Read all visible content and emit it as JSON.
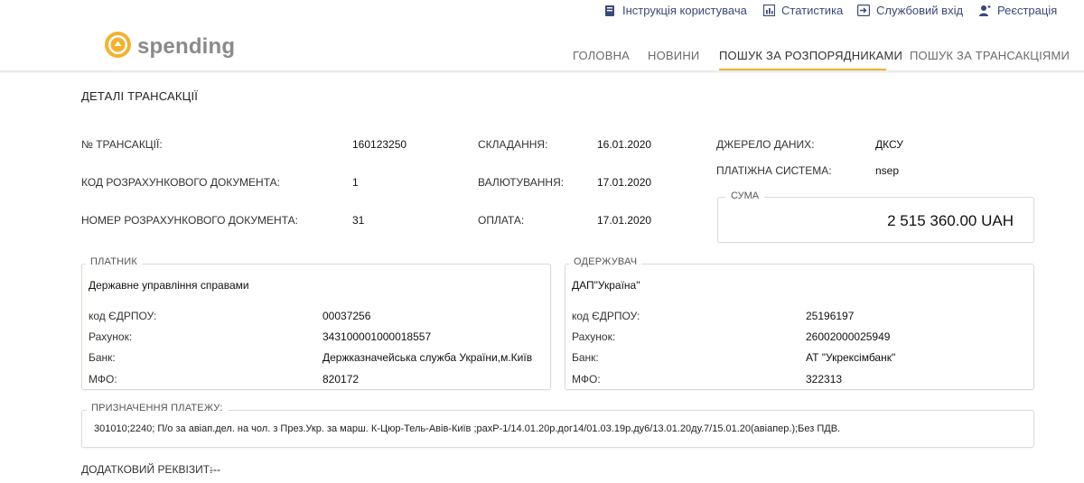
{
  "topbar": {
    "links": [
      {
        "label": "Інструкція користувача",
        "icon": "book-icon"
      },
      {
        "label": "Статистика",
        "icon": "chart-icon"
      },
      {
        "label": "Службовий вхід",
        "icon": "login-icon"
      },
      {
        "label": "Реєстрація",
        "icon": "user-add-icon"
      }
    ]
  },
  "logo": {
    "text": "spending",
    "accent": "#f2b231"
  },
  "nav": {
    "items": [
      "ГОЛОВНА",
      "НОВИНИ",
      "ПОШУК ЗА РОЗПОРЯДНИКАМИ",
      "ПОШУК ЗА ТРАНСАКЦІЯМИ"
    ],
    "active": "ПОШУК ЗА РОЗПОРЯДНИКАМИ"
  },
  "page": {
    "title": "ДЕТАЛІ ТРАНСАКЦІЇ"
  },
  "details": {
    "transaction_no_label": "№ ТРАНСАКЦІЇ:",
    "transaction_no": "160123250",
    "doc_code_label": "КОД РОЗРАХУНКОВОГО ДОКУМЕНТА:",
    "doc_code": "1",
    "doc_number_label": "НОМЕР РОЗРАХУНКОВОГО ДОКУМЕНТА:",
    "doc_number": "31",
    "created_label": "СКЛАДАННЯ:",
    "created": "16.01.2020",
    "value_date_label": "ВАЛЮТУВАННЯ:",
    "value_date": "17.01.2020",
    "payment_label": "ОПЛАТА:",
    "payment": "17.01.2020",
    "source_label": "ДЖЕРЕЛО ДАНИХ:",
    "source": "ДКСУ",
    "pay_system_label": "ПЛАТІЖНА СИСТЕМА:",
    "pay_system": "nsep",
    "sum_label": "СУМА",
    "sum": "2 515 360.00 UAH"
  },
  "payer": {
    "legend": "ПЛАТНИК",
    "name": "Державне управління справами",
    "edrpou_label": "код ЄДРПОУ:",
    "edrpou": "00037256",
    "account_label": "Рахунок:",
    "account": "34310000100001​8557",
    "bank_label": "Банк:",
    "bank": "Держказначейська служба України,м.Київ",
    "mfo_label": "МФО:",
    "mfo": "820172"
  },
  "receiver": {
    "legend": "ОДЕРЖУВАЧ",
    "name": "ДАП\"Україна\"",
    "edrpou_label": "код ЄДРПОУ:",
    "edrpou": "25196197",
    "account_label": "Рахунок:",
    "account": "26002000025949",
    "bank_label": "Банк:",
    "bank": "АТ \"Укрексімбанк\"",
    "mfo_label": "МФО:",
    "mfo": "322313"
  },
  "purpose": {
    "legend": "ПРИЗНАЧЕННЯ ПЛАТЕЖУ:",
    "text": "301010;2240; П/о за авіап.дел. на чол. з През.Укр. за марш. К-Цюр-Тель-Авів-Київ ;рахР-1/14.01.20р.дог14/01.03.19р.ду6/13.01.20ду.7/15.01.20(авіапер.);Без ПДВ."
  },
  "extra": {
    "label": "ДОДАТКОВИЙ РЕКВІЗИТ:",
    "value": "---"
  }
}
